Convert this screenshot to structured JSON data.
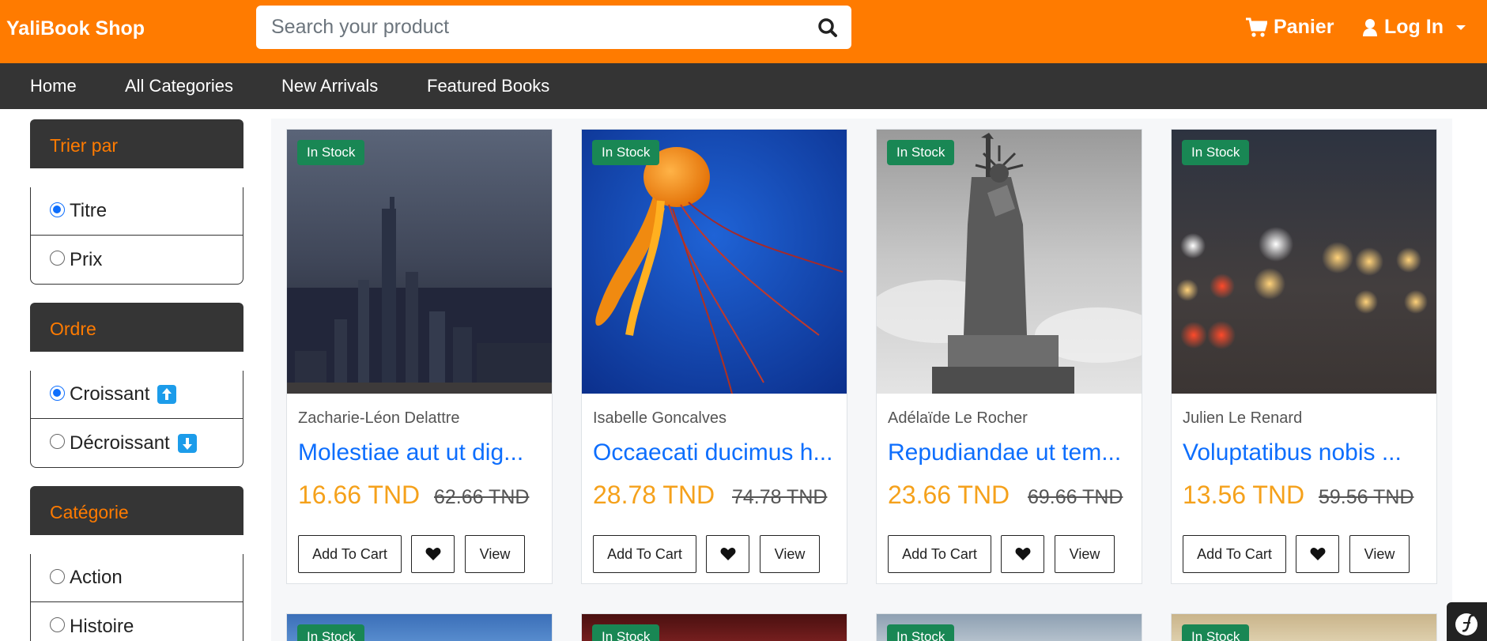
{
  "header": {
    "brand": "YaliBook Shop",
    "search_placeholder": "Search your product",
    "cart_label": "Panier",
    "login_label": "Log In"
  },
  "nav": {
    "items": [
      "Home",
      "All Categories",
      "New Arrivals",
      "Featured Books"
    ]
  },
  "sidebar": {
    "sort_title": "Trier par",
    "sort_options": [
      "Titre",
      "Prix"
    ],
    "order_title": "Ordre",
    "order_options": [
      "Croissant",
      "Décroissant"
    ],
    "category_title": "Catégorie",
    "category_options": [
      "Action",
      "Histoire"
    ]
  },
  "products": [
    {
      "badge": "In Stock",
      "author": "Zacharie-Léon Delattre",
      "title": "Molestiae aut ut dig...",
      "price": "16.66 TND",
      "old_price": "62.66 TND"
    },
    {
      "badge": "In Stock",
      "author": "Isabelle Goncalves",
      "title": "Occaecati ducimus h...",
      "price": "28.78 TND",
      "old_price": "74.78 TND"
    },
    {
      "badge": "In Stock",
      "author": "Adélaïde Le Rocher",
      "title": "Repudiandae ut tem...",
      "price": "23.66 TND",
      "old_price": "69.66 TND"
    },
    {
      "badge": "In Stock",
      "author": "Julien Le Renard",
      "title": "Voluptatibus nobis ...",
      "price": "13.56 TND",
      "old_price": "59.56 TND"
    }
  ],
  "product_buttons": {
    "add_to_cart": "Add To Cart",
    "view": "View"
  },
  "next_row_badges": [
    "In Stock",
    "In Stock",
    "In Stock",
    "In Stock"
  ],
  "colors": {
    "brand_orange": "#ff7b00",
    "nav_dark": "#343434",
    "stock_green": "#198754",
    "title_blue": "#0d6efd",
    "price_orange": "#f5a11b"
  }
}
